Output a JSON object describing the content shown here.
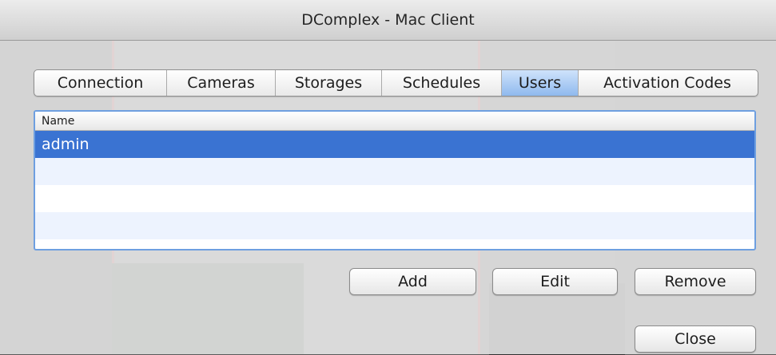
{
  "window": {
    "title": "DComplex - Mac Client"
  },
  "tabs": [
    {
      "label": "Connection",
      "selected": false
    },
    {
      "label": "Cameras",
      "selected": false
    },
    {
      "label": "Storages",
      "selected": false
    },
    {
      "label": "Schedules",
      "selected": false
    },
    {
      "label": "Users",
      "selected": true
    },
    {
      "label": "Activation Codes",
      "selected": false
    }
  ],
  "users_table": {
    "columns": [
      "Name"
    ],
    "rows": [
      "admin",
      "",
      "",
      ""
    ]
  },
  "buttons": {
    "add": "Add",
    "edit": "Edit",
    "remove": "Remove",
    "close": "Close"
  },
  "colors": {
    "selection": "#3a73d2",
    "tab_selected": "#a8ccf4"
  }
}
